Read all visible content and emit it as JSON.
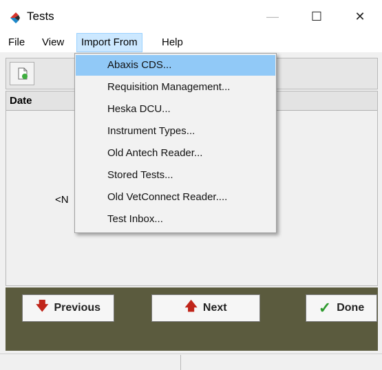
{
  "window": {
    "title": "Tests",
    "controls": {
      "minimize": "—",
      "maximize": "☐",
      "close": "✕"
    }
  },
  "menubar": {
    "items": [
      "File",
      "View",
      "Import From",
      "Help"
    ],
    "active_index": 2
  },
  "toolbar": {
    "button_icon": "document-icon"
  },
  "grid": {
    "columns": [
      "Date"
    ],
    "empty_text": "<N"
  },
  "import_menu": {
    "items": [
      "Abaxis CDS...",
      "Requisition Management...",
      "Heska DCU...",
      "Instrument Types...",
      "Old Antech Reader...",
      "Stored Tests...",
      "Old VetConnect Reader....",
      "Test Inbox..."
    ],
    "highlighted_index": 0
  },
  "buttons": {
    "previous": "Previous",
    "next": "Next",
    "done": "Done"
  },
  "colors": {
    "bottom_panel": "#5b5b3e",
    "highlight": "#91c9f7",
    "arrow": "#c0251a",
    "check": "#2e9a2e"
  }
}
